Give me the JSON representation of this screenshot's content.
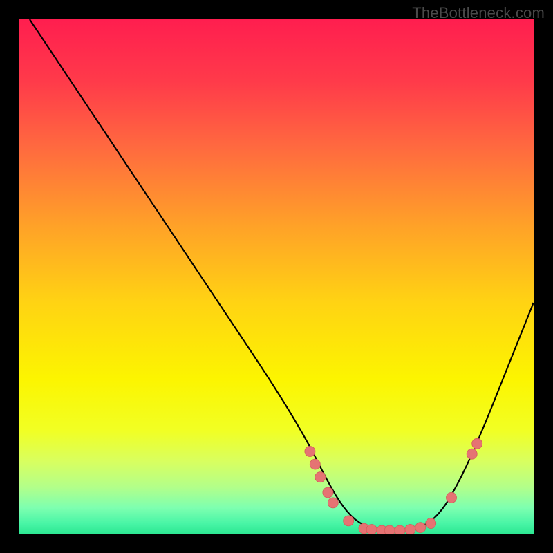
{
  "watermark": "TheBottleneck.com",
  "chart_data": {
    "type": "line",
    "title": "",
    "xlabel": "",
    "ylabel": "",
    "xlim": [
      0,
      100
    ],
    "ylim": [
      0,
      100
    ],
    "curve": {
      "x": [
        2,
        10,
        20,
        30,
        40,
        50,
        56,
        60,
        63,
        66,
        70,
        74,
        78,
        82,
        86,
        90,
        94,
        98,
        100
      ],
      "y": [
        100,
        88,
        73,
        58,
        43,
        28,
        18,
        10,
        5,
        2,
        0.5,
        0.5,
        1,
        4,
        11,
        20,
        30,
        40,
        45
      ]
    },
    "scatter_points": [
      {
        "x": 56.5,
        "y": 16
      },
      {
        "x": 57.5,
        "y": 13.5
      },
      {
        "x": 58.5,
        "y": 11
      },
      {
        "x": 60,
        "y": 8
      },
      {
        "x": 61,
        "y": 6
      },
      {
        "x": 64,
        "y": 2.5
      },
      {
        "x": 67,
        "y": 1
      },
      {
        "x": 68.5,
        "y": 0.8
      },
      {
        "x": 70.5,
        "y": 0.6
      },
      {
        "x": 72,
        "y": 0.6
      },
      {
        "x": 74,
        "y": 0.6
      },
      {
        "x": 76,
        "y": 0.8
      },
      {
        "x": 78,
        "y": 1.2
      },
      {
        "x": 80,
        "y": 2
      },
      {
        "x": 84,
        "y": 7
      },
      {
        "x": 88,
        "y": 15.5
      },
      {
        "x": 89,
        "y": 17.5
      }
    ],
    "gradient_stops": [
      {
        "pct": 0,
        "color": "#ff1e4f"
      },
      {
        "pct": 12,
        "color": "#ff3a4a"
      },
      {
        "pct": 25,
        "color": "#ff6a3f"
      },
      {
        "pct": 40,
        "color": "#ffa128"
      },
      {
        "pct": 55,
        "color": "#ffd313"
      },
      {
        "pct": 70,
        "color": "#fcf500"
      },
      {
        "pct": 80,
        "color": "#f1ff24"
      },
      {
        "pct": 86,
        "color": "#d8ff60"
      },
      {
        "pct": 91,
        "color": "#b2ff8a"
      },
      {
        "pct": 95,
        "color": "#7dffb0"
      },
      {
        "pct": 98,
        "color": "#49f5a6"
      },
      {
        "pct": 100,
        "color": "#2de893"
      }
    ],
    "colors": {
      "curve": "#000000",
      "points_fill": "#e57373",
      "points_stroke": "#d45a5a",
      "background": "#000000"
    }
  }
}
